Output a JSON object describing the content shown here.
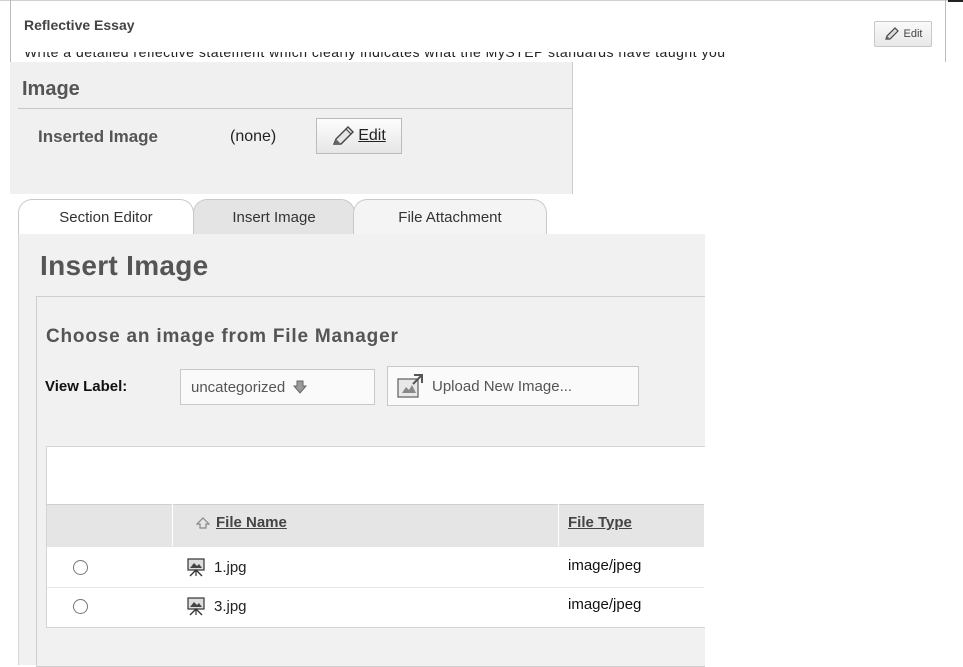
{
  "essay": {
    "title": "Reflective Essay",
    "edit_label": "Edit",
    "cutoff_text": "Write a detailed reflective statement which clearly indicates what the MySTEP standards have taught you"
  },
  "image_section": {
    "heading": "Image",
    "inserted_label": "Inserted Image",
    "inserted_value": "(none)",
    "edit_label": "Edit"
  },
  "tabs": [
    {
      "label": "Section Editor"
    },
    {
      "label": "Insert Image"
    },
    {
      "label": "File Attachment"
    }
  ],
  "insert_image": {
    "title": "Insert Image",
    "choose_heading": "Choose an image from File Manager",
    "view_label": "View Label:",
    "label_select_value": "uncategorized",
    "upload_label": "Upload New Image..."
  },
  "grid": {
    "columns": [
      "File Name",
      "File Type"
    ],
    "rows": [
      {
        "name": "1.jpg",
        "type": "image/jpeg"
      },
      {
        "name": "3.jpg",
        "type": "image/jpeg"
      }
    ]
  },
  "icons": {
    "edit": "pencil-icon",
    "sort": "sort-up-icon",
    "dropdown": "down-arrow-icon",
    "upload": "upload-image-icon",
    "file": "image-file-icon"
  }
}
